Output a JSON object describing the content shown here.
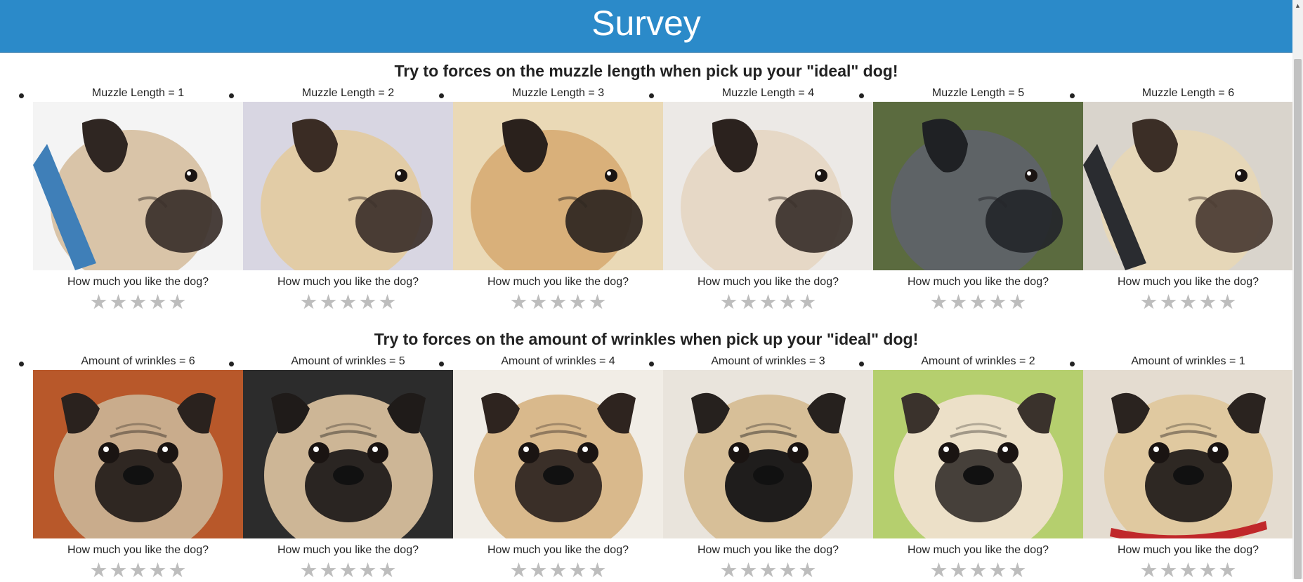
{
  "header": {
    "title": "Survey"
  },
  "sections": [
    {
      "title": "Try to forces on the muzzle length when pick up your \"ideal\" dog!",
      "cards": [
        {
          "label": "Muzzle Length = 1",
          "question": "How much you like the dog?",
          "bg": "#f4f4f4",
          "fur": "#d9c4a8",
          "mask": "#3a2f2a",
          "ear": "#2f2622",
          "view": "side",
          "collar": "#3f7fb8"
        },
        {
          "label": "Muzzle Length = 2",
          "question": "How much you like the dog?",
          "bg": "#d8d6e2",
          "fur": "#e2cca6",
          "mask": "#3c302a",
          "ear": "#3a2c24",
          "view": "side"
        },
        {
          "label": "Muzzle Length = 3",
          "question": "How much you like the dog?",
          "bg": "#ead9b6",
          "fur": "#d9b07a",
          "mask": "#2e2520",
          "ear": "#2a211c",
          "view": "side"
        },
        {
          "label": "Muzzle Length = 4",
          "question": "How much you like the dog?",
          "bg": "#ece9e6",
          "fur": "#e6d8c6",
          "mask": "#3a302a",
          "ear": "#2b221e",
          "view": "side"
        },
        {
          "label": "Muzzle Length = 5",
          "question": "How much you like the dog?",
          "bg": "#5b6b3f",
          "fur": "#5e6366",
          "mask": "#24262a",
          "ear": "#1f2124",
          "view": "side"
        },
        {
          "label": "Muzzle Length = 6",
          "question": "How much you like the dog?",
          "bg": "#d9d4cc",
          "fur": "#e6d7b8",
          "mask": "#4a3b32",
          "ear": "#3b2e26",
          "view": "side",
          "collar": "#2a2c30"
        }
      ]
    },
    {
      "title": "Try to forces on the amount of wrinkles when pick up your \"ideal\" dog!",
      "cards": [
        {
          "label": "Amount of wrinkles = 6",
          "question": "How much you like the dog?",
          "bg": "#b8582a",
          "fur": "#c9ac8c",
          "mask": "#2f2722",
          "ear": "#2a221e",
          "view": "front"
        },
        {
          "label": "Amount of wrinkles = 5",
          "question": "How much you like the dog?",
          "bg": "#2c2c2c",
          "fur": "#cdb696",
          "mask": "#2a2522",
          "ear": "#1f1b19",
          "view": "front"
        },
        {
          "label": "Amount of wrinkles = 4",
          "question": "How much you like the dog?",
          "bg": "#f1ede6",
          "fur": "#d9b98c",
          "mask": "#3a2f28",
          "ear": "#2e241f",
          "view": "front"
        },
        {
          "label": "Amount of wrinkles = 3",
          "question": "How much you like the dog?",
          "bg": "#e9e4dc",
          "fur": "#d7bf98",
          "mask": "#1f1d1c",
          "ear": "#26211e",
          "view": "front"
        },
        {
          "label": "Amount of wrinkles = 2",
          "question": "How much you like the dog?",
          "bg": "#b5cf6e",
          "fur": "#ece0c8",
          "mask": "#46403a",
          "ear": "#3a322c",
          "view": "front"
        },
        {
          "label": "Amount of wrinkles = 1",
          "question": "How much you like the dog?",
          "bg": "#e4dcd0",
          "fur": "#e0c9a0",
          "mask": "#2e2823",
          "ear": "#2a231f",
          "view": "front",
          "collar": "#c0282a"
        }
      ]
    }
  ],
  "rating": {
    "star_glyph": "★",
    "max": 5,
    "value": 0
  }
}
